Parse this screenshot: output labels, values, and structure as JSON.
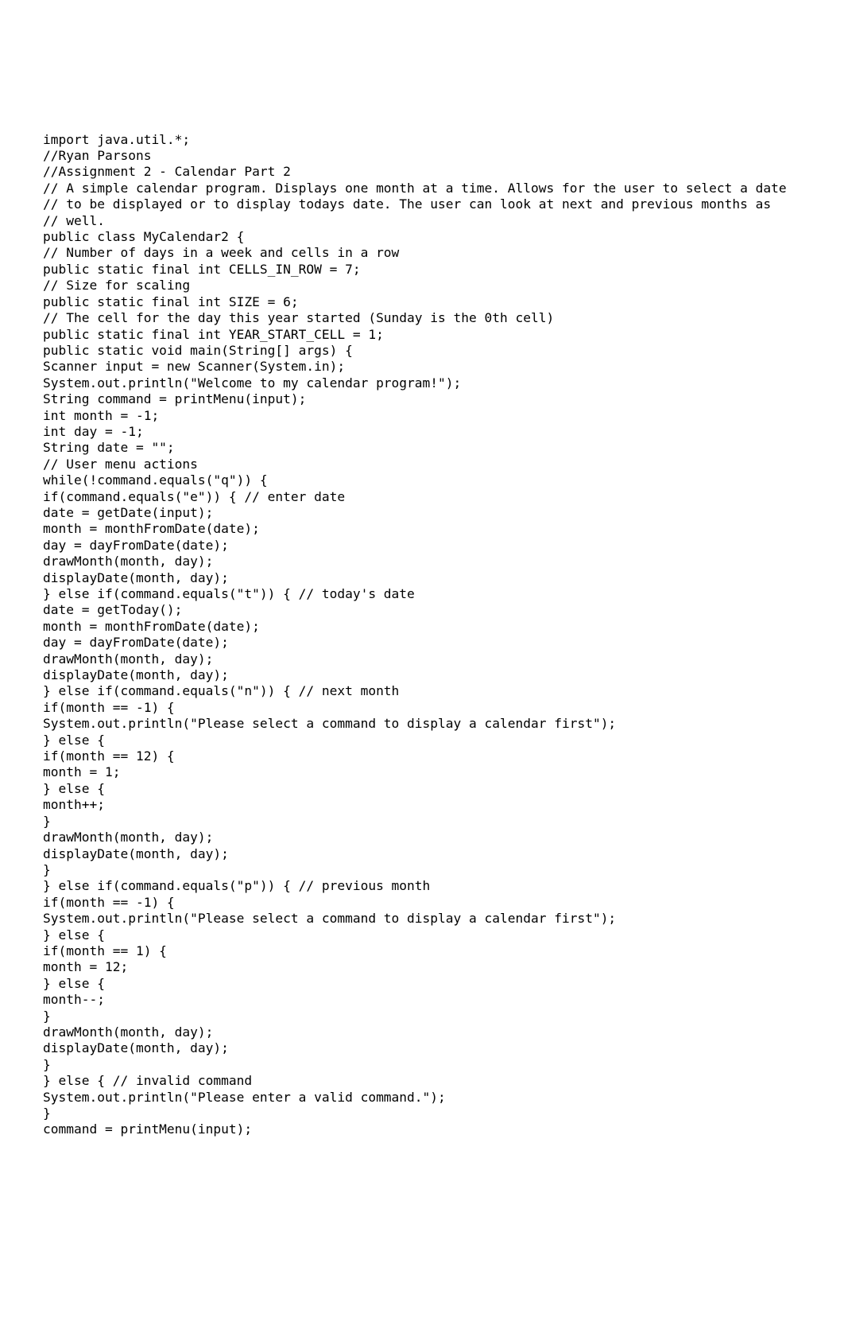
{
  "code_lines": [
    "import java.util.*;",
    "//Ryan Parsons",
    "//Assignment 2 - Calendar Part 2",
    "// A simple calendar program. Displays one month at a time. Allows for the user to select a date",
    "// to be displayed or to display todays date. The user can look at next and previous months as",
    "// well.",
    "public class MyCalendar2 {",
    "// Number of days in a week and cells in a row",
    "public static final int CELLS_IN_ROW = 7;",
    "// Size for scaling",
    "public static final int SIZE = 6;",
    "// The cell for the day this year started (Sunday is the 0th cell)",
    "public static final int YEAR_START_CELL = 1;",
    "public static void main(String[] args) {",
    "Scanner input = new Scanner(System.in);",
    "System.out.println(\"Welcome to my calendar program!\");",
    "String command = printMenu(input);",
    "int month = -1;",
    "int day = -1;",
    "String date = \"\";",
    "// User menu actions",
    "while(!command.equals(\"q\")) {",
    "if(command.equals(\"e\")) { // enter date",
    "date = getDate(input);",
    "month = monthFromDate(date);",
    "day = dayFromDate(date);",
    "drawMonth(month, day);",
    "displayDate(month, day);",
    "} else if(command.equals(\"t\")) { // today's date",
    "date = getToday();",
    "month = monthFromDate(date);",
    "day = dayFromDate(date);",
    "drawMonth(month, day);",
    "displayDate(month, day);",
    "} else if(command.equals(\"n\")) { // next month",
    "if(month == -1) {",
    "System.out.println(\"Please select a command to display a calendar first\");",
    "} else {",
    "if(month == 12) {",
    "month = 1;",
    "} else {",
    "month++;",
    "}",
    "drawMonth(month, day);",
    "displayDate(month, day);",
    "}",
    "} else if(command.equals(\"p\")) { // previous month",
    "if(month == -1) {",
    "System.out.println(\"Please select a command to display a calendar first\");",
    "} else {",
    "if(month == 1) {",
    "month = 12;",
    "} else {",
    "month--;",
    "}",
    "drawMonth(month, day);",
    "displayDate(month, day);",
    "}",
    "} else { // invalid command",
    "System.out.println(\"Please enter a valid command.\");",
    "}",
    "command = printMenu(input);"
  ]
}
